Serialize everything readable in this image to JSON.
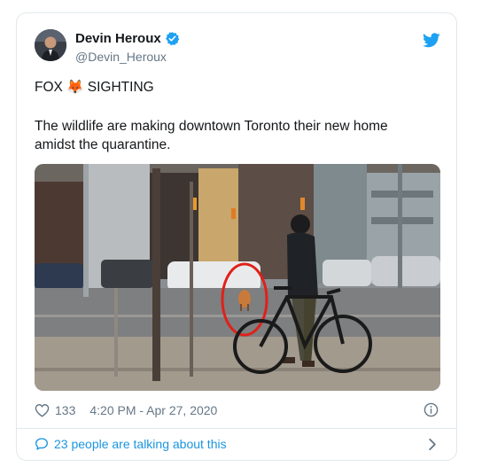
{
  "tweet": {
    "author_name": "Devin Heroux",
    "handle": "@Devin_Heroux",
    "line1": "FOX 🦊 SIGHTING",
    "line2": "The wildlife are making downtown Toronto their new home amidst the quarantine.",
    "likes": "133",
    "timestamp": "4:20 PM - Apr 27, 2020",
    "talking": "23 people are talking about this"
  },
  "colors": {
    "twitter_blue": "#1da1f2",
    "link_blue": "#1b95e0",
    "muted": "#657786",
    "highlight_red": "#e0201a"
  },
  "icons": [
    "verified-badge-icon",
    "twitter-bird-icon",
    "heart-icon",
    "info-icon",
    "comment-icon",
    "chevron-right-icon"
  ]
}
